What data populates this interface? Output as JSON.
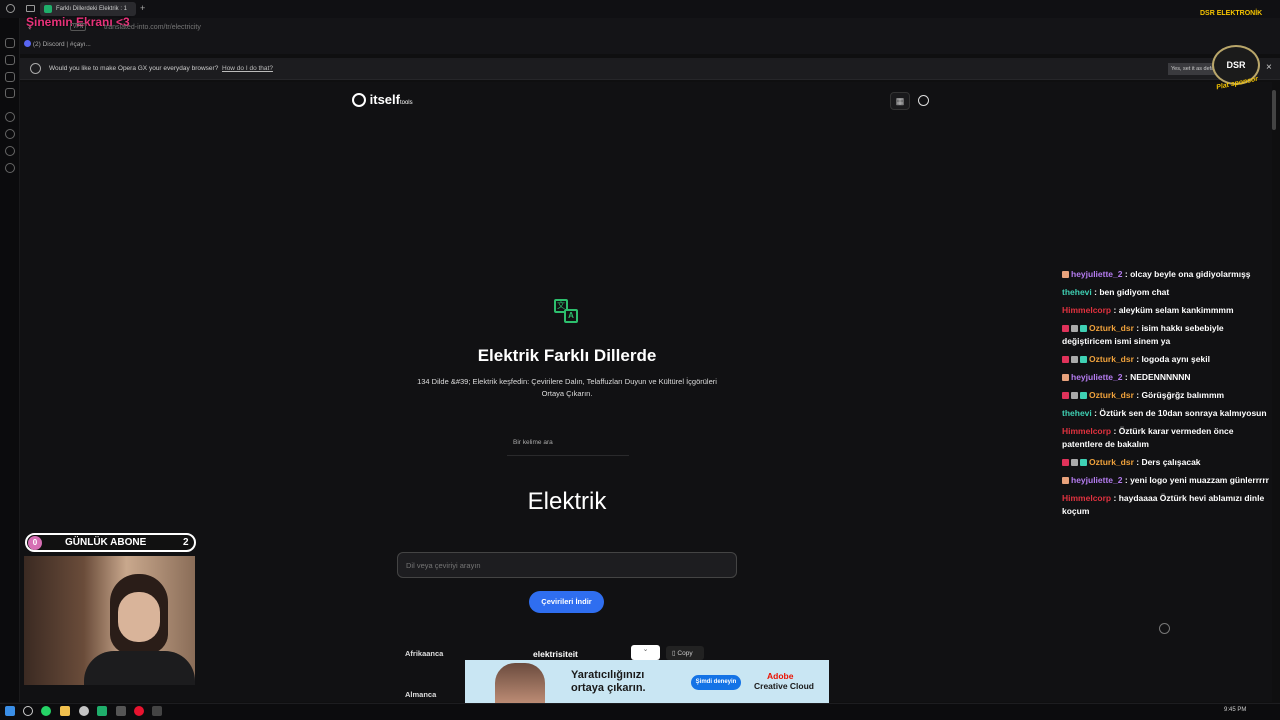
{
  "browser": {
    "tab_title": "Farklı Dillerdeki Elektrik : 1",
    "address": "translated-into.com/tr/electricity",
    "bookmark": "(2) Discord | #çayı...",
    "notice_text": "Would you like to make Opera GX your everyday browser?",
    "notice_link": "How do I do that?",
    "notice_button": "Yes, set it as default"
  },
  "overlay": {
    "title": "Şinemin Ekranı <3",
    "sponsor_top": "DSR ELEKTRONİK",
    "sponsor_seal": "DSR",
    "sponsor_bottom": "Plat sponsor",
    "sub_count_label": "GÜNLÜK ABONE",
    "sub_left": "0",
    "sub_right": "2"
  },
  "site": {
    "logo": "itself",
    "logo_small": "tools",
    "grid_icon": "grid-icon",
    "globe_icon": "globe-icon",
    "title": "Elektrik Farklı Dillerde",
    "subtitle": "134 Dilde &#39; Elektrik keşfedin: Çevirilere Dalın, Telaffuzları Duyun ve Kültürel İçgörüleri Ortaya Çıkarın.",
    "word_search_placeholder": "Bir kelime ara",
    "word": "Elektrik",
    "lang_search_placeholder": "Dil veya çeviriyi arayın",
    "download_button": "Çevirileri İndir",
    "rows": [
      {
        "lang": "Afrikaanca",
        "translation": "elektrisiteit",
        "copy": "Copy"
      },
      {
        "lang": "Almanca",
        "translation": "",
        "copy": ""
      }
    ]
  },
  "ad": {
    "headline": "Yaratıcılığınızı ortaya çıkarın.",
    "cta": "Şimdi deneyin",
    "brand": "Adobe",
    "product": "Creative Cloud"
  },
  "chat": [
    {
      "user": "heyjuliette_2",
      "color": "#b57cf0",
      "text": ": olcay beyle ona gidiyolarmışş"
    },
    {
      "user": "thehevi",
      "color": "#3fd1b4",
      "text": ": ben gidiyom chat"
    },
    {
      "user": "Himmelcorp",
      "color": "#e0323f",
      "text": ": aleyküm selam kankimmmm"
    },
    {
      "user": "Ozturk_dsr",
      "color": "#f0a23c",
      "text": ": isim hakkı sebebiyle değiştiricem ismi sinem ya"
    },
    {
      "user": "Ozturk_dsr",
      "color": "#f0a23c",
      "text": ": logoda aynı şekil"
    },
    {
      "user": "heyjuliette_2",
      "color": "#b57cf0",
      "text": ": NEDENNNNNN"
    },
    {
      "user": "Ozturk_dsr",
      "color": "#f0a23c",
      "text": ": Görüşğrğz balımmm"
    },
    {
      "user": "thehevi",
      "color": "#3fd1b4",
      "text": ": Öztürk sen de 10dan sonraya kalmıyosun"
    },
    {
      "user": "Himmelcorp",
      "color": "#e0323f",
      "text": ": Öztürk karar vermeden önce patentlere de bakalım"
    },
    {
      "user": "Ozturk_dsr",
      "color": "#f0a23c",
      "text": ": Ders çalışacak"
    },
    {
      "user": "heyjuliette_2",
      "color": "#b57cf0",
      "text": ": yeni logo yeni muazzam günlerrrrr"
    },
    {
      "user": "Himmelcorp",
      "color": "#e0323f",
      "text": ": haydaaaa Öztürk hevi ablamızı dinle koçum"
    }
  ],
  "taskbar": {
    "time": "9:45 PM"
  }
}
